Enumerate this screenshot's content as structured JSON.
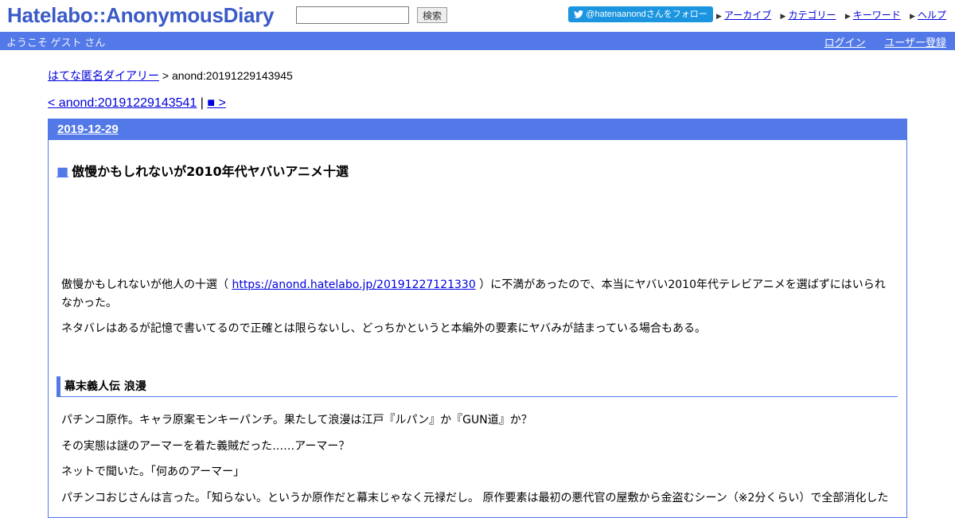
{
  "header": {
    "logo": "Hatelabo::AnonymousDiary",
    "search_button": "検索",
    "search_value": "",
    "follow_button": "@hatenaanondさんをフォロー",
    "nav": [
      "アーカイブ",
      "カテゴリー",
      "キーワード",
      "ヘルプ"
    ]
  },
  "userbar": {
    "welcome": "ようこそ ゲスト さん",
    "login": "ログイン",
    "register": "ユーザー登録"
  },
  "breadcrumb": {
    "home": "はてな匿名ダイアリー",
    "sep": ">",
    "current": "anond:20191229143945"
  },
  "pager": {
    "prev": "< anond:20191229143541",
    "sep": "|",
    "next": "■ >"
  },
  "entry": {
    "date": "2019-12-29",
    "title_mark": "■",
    "title": "傲慢かもしれないが2010年代ヤバいアニメ十選",
    "p1_a": "傲慢かもしれないが他人の十選（ ",
    "p1_link": "https://anond.hatelabo.jp/20191227121330",
    "p1_b": " ）に不満があったので、本当にヤバい2010年代テレビアニメを選ばずにはいられなかった。",
    "p2": "ネタバレはあるが記憶で書いてるので正確とは限らないし、どっちかというと本編外の要素にヤバみが詰まっている場合もある。",
    "section_title": "幕末義人伝 浪漫",
    "s1": "パチンコ原作。キャラ原案モンキーパンチ。果たして浪漫は江戸『ルパン』か『GUN道』か？",
    "s2": "その実態は謎のアーマーを着た義賊だった……アーマー？",
    "s3": "ネットで聞いた。「何あのアーマー」",
    "s4": "パチンコおじさんは言った。「知らない。というか原作だと幕末じゃなく元禄だし。 原作要素は最初の悪代官の屋敷から金盗むシーン（※2分くらい）で全部消化した"
  },
  "colors": {
    "accent": "#5279e7",
    "logo": "#3a5bc7",
    "link": "#0000de",
    "twitter": "#1b95e0"
  }
}
